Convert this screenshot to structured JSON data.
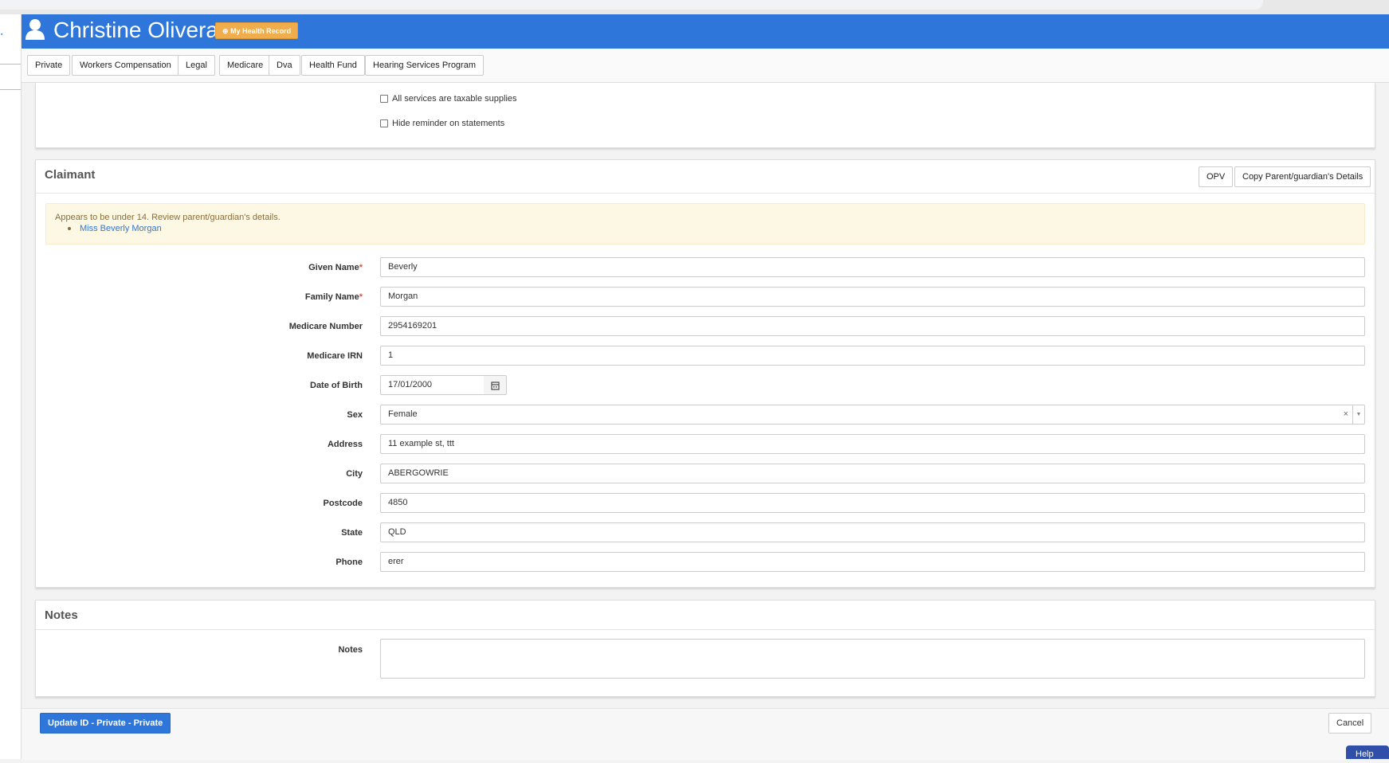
{
  "header": {
    "user_name": "Christine Olivera",
    "my_health_record_label": "My Health Record",
    "brand_color": "#2f76db"
  },
  "tabs": [
    "Private",
    "Workers Compensation",
    "Legal",
    "Medicare",
    "Dva",
    "Health Fund",
    "Hearing Services Program"
  ],
  "settings": {
    "taxable_label": "All services are taxable supplies",
    "taxable_checked": false,
    "hide_reminder_label": "Hide reminder on statements",
    "hide_reminder_checked": false
  },
  "claimant": {
    "title": "Claimant",
    "opv_label": "OPV",
    "copy_label": "Copy Parent/guardian's Details",
    "alert_message": "Appears to be under 14. Review parent/guardian's details.",
    "alert_link": "Miss Beverly Morgan",
    "fields": {
      "given_name": {
        "label": "Given Name",
        "required_mark": "*",
        "value": "Beverly"
      },
      "family_name": {
        "label": "Family Name",
        "required_mark": "*",
        "value": "Morgan"
      },
      "medicare_number": {
        "label": "Medicare Number",
        "value": "2954169201"
      },
      "medicare_irn": {
        "label": "Medicare IRN",
        "value": "1"
      },
      "dob": {
        "label": "Date of Birth",
        "value": "17/01/2000"
      },
      "sex": {
        "label": "Sex",
        "value": "Female",
        "clear": "×",
        "arrow": "▼"
      },
      "address": {
        "label": "Address",
        "value": "11 example st, ttt"
      },
      "city": {
        "label": "City",
        "value": "ABERGOWRIE"
      },
      "postcode": {
        "label": "Postcode",
        "value": "4850"
      },
      "state": {
        "label": "State",
        "value": "QLD"
      },
      "phone": {
        "label": "Phone",
        "value": "erer"
      }
    }
  },
  "notes": {
    "title": "Notes",
    "label": "Notes",
    "value": ""
  },
  "footer": {
    "update_label": "Update ID - Private - Private",
    "cancel_label": "Cancel",
    "help_label": "Help"
  }
}
